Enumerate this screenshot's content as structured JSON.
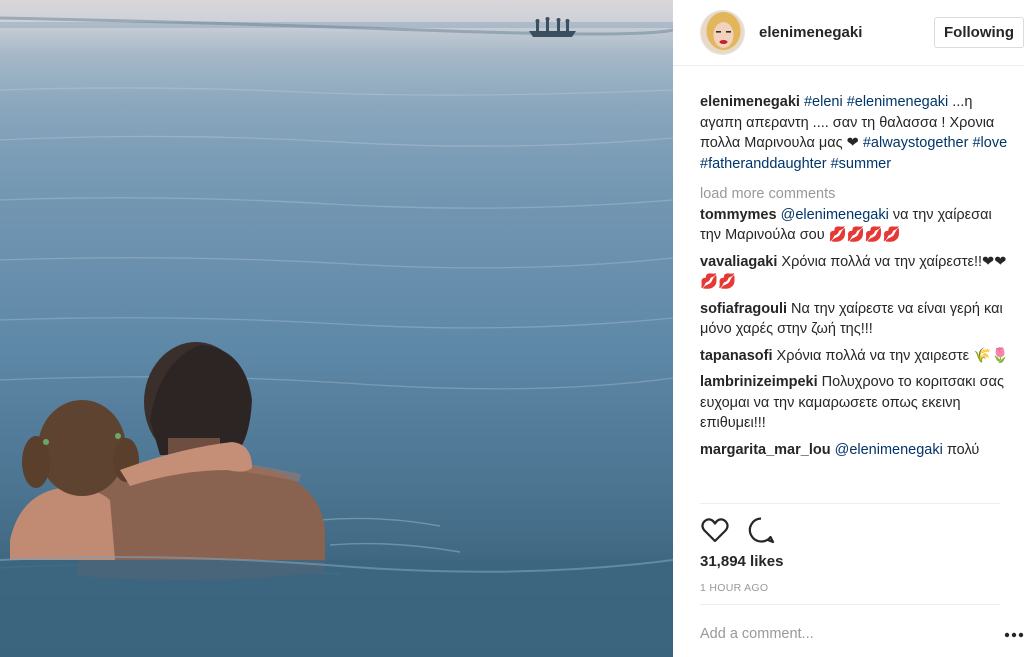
{
  "post": {
    "username": "elenimenegaki",
    "follow_label": "Following",
    "caption": {
      "username": "elenimenegaki",
      "tag1": "#eleni",
      "tag2": "#elenimenegaki",
      "text1": " ...η αγαπη απεραντη .... σαν τη θαλασσα ! Χρονια πολλα Μαρινουλα μας ",
      "heart": "❤",
      "tag3": "#alwaystogether",
      "tag4": "#love",
      "tag5": "#fatheranddaughter",
      "tag6": "#summer"
    },
    "load_more": "load more comments",
    "comments": [
      {
        "username": "tommymes",
        "mention": "@elenimenegaki",
        "text": " να την χαίρεσαι την Μαρινούλα σου 💋💋💋💋"
      },
      {
        "username": "vavaliagaki",
        "text": " Χρόνια πολλά να την χαίρεστε!!❤❤💋💋"
      },
      {
        "username": "sofiafragouli",
        "text": " Να την χαίρεστε να είναι γερή και μόνο χαρές στην ζωή της!!!"
      },
      {
        "username": "tapanasofi",
        "text": " Χρόνια πολλά να την χαιρεστε 🌾🌷"
      },
      {
        "username": "lambrinizeimpeki",
        "text": " Πολυχρονο το κοριτσακι σας ευχομαι να την καμαρωσετε οπως εκεινη επιθυμει!!!"
      },
      {
        "username": "margarita_mar_lou",
        "mention": "@elenimenegaki",
        "text": " πολύ"
      }
    ],
    "likes": "31,894 likes",
    "time": "1 HOUR AGO",
    "add_comment_placeholder": "Add a comment...",
    "icons": {
      "like": "heart-outline-icon",
      "comment": "speech-bubble-icon",
      "more": "three-dots-icon"
    }
  },
  "colors": {
    "link": "#003569",
    "muted": "#999999",
    "text": "#262626",
    "border": "#efefef"
  }
}
